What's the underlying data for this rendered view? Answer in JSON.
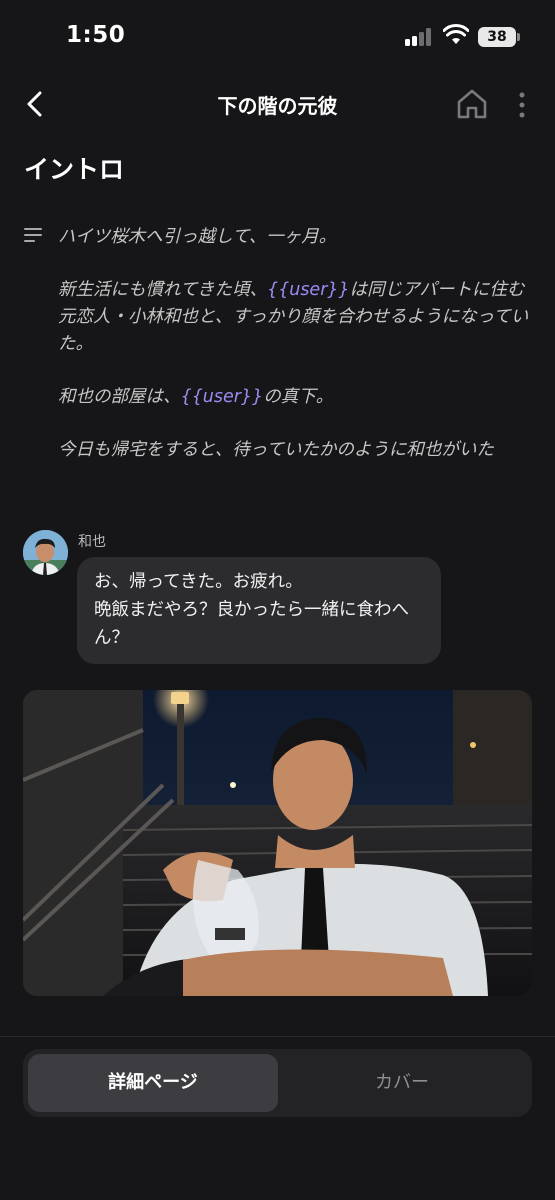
{
  "status_bar": {
    "time": "1:50",
    "battery": "38",
    "icons": [
      "cellular-signal-icon",
      "wifi-icon",
      "battery-icon"
    ]
  },
  "nav": {
    "title": "下の階の元彼",
    "icons": [
      "chevron-left-icon",
      "home-icon",
      "more-vertical-icon"
    ]
  },
  "section": {
    "title": "イントロ",
    "icon": "text-lines-icon"
  },
  "intro": {
    "p1": "ハイツ桜木へ引っ越して、一ヶ月。",
    "p2_before": "新生活にも慣れてきた頃、",
    "p2_user": "{{user}}",
    "p2_after": "は同じアパートに住む元恋人・小林和也と、すっかり顔を合わせるようになっていた。",
    "p3_before": "和也の部屋は、",
    "p3_user": "{{user}}",
    "p3_after": "の真下。",
    "p4": "今日も帰宅をすると、待っていたかのように和也がいた"
  },
  "message": {
    "speaker": "和也",
    "line1": "お、帰ってきた。お疲れ。",
    "line2": "晩飯まだやろ？良かったら一緒に食わへん？"
  },
  "tabs": {
    "details": "詳細ページ",
    "cover": "カバー"
  },
  "colors": {
    "background": "#161618",
    "bubble": "#2c2c2f",
    "user_tag": "#9b8cf2",
    "tab_active": "#3d3d41"
  }
}
